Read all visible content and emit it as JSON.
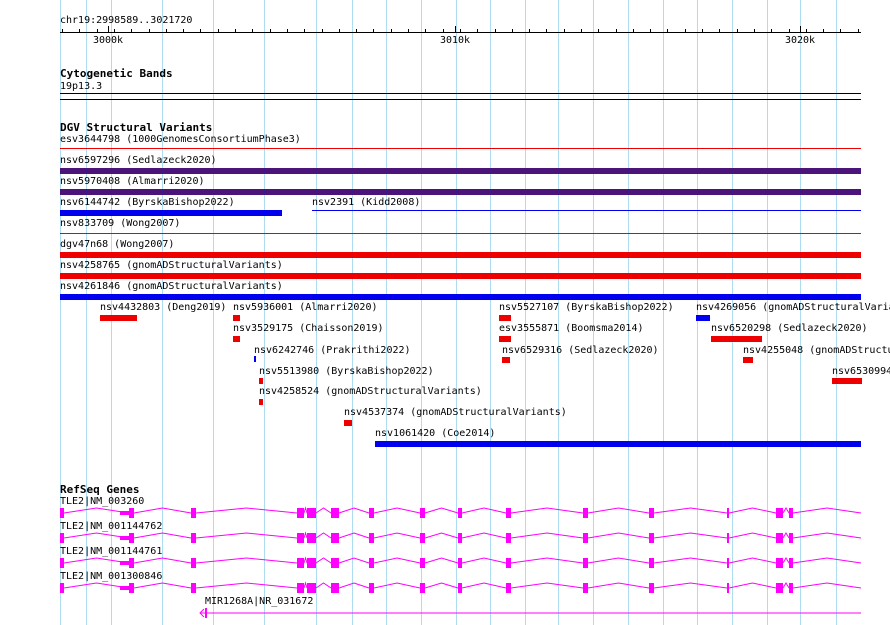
{
  "colors": {
    "grid": "#aeddf2",
    "red": "#ee0000",
    "purple": "#4a147a",
    "blue": "#0000ee",
    "gene": "#ff00ff"
  },
  "ruler": {
    "position": "chr19:2998589..3021720",
    "ticks": [
      {
        "label": "3000k"
      },
      {
        "label": "3010k"
      },
      {
        "label": "3020k"
      }
    ]
  },
  "cytobands": {
    "title": "Cytogenetic Bands",
    "band": "19p13.3"
  },
  "dgv": {
    "title": "DGV Structural Variants",
    "features": [
      {
        "label": "esv3644798 (1000GenomesConsortiumPhase3)",
        "color": "red",
        "style": "thin"
      },
      {
        "label": "nsv6597296 (Sedlazeck2020)",
        "color": "purple",
        "style": "thick"
      },
      {
        "label": "nsv5970408 (Almarri2020)",
        "color": "purple",
        "style": "thick"
      },
      {
        "label": "nsv6144742 (ByrskaBishop2022)",
        "color": "blue",
        "style": "thick"
      },
      {
        "label": "nsv2391 (Kidd2008)",
        "color": "blue",
        "style": "thin"
      },
      {
        "label": "nsv833709 (Wong2007)",
        "color": "red",
        "style": "thin"
      },
      {
        "label": "dgv47n68 (Wong2007)",
        "color": "red",
        "style": "thick"
      },
      {
        "label": "nsv4258765 (gnomADStructuralVariants)",
        "color": "red",
        "style": "thick"
      },
      {
        "label": "nsv4261846 (gnomADStructuralVariants)",
        "color": "blue",
        "style": "thick"
      },
      {
        "label": "nsv4432803 (Deng2019)",
        "color": "red",
        "style": "thick"
      },
      {
        "label": "nsv5936001 (Almarri2020)",
        "color": "red",
        "style": "thick"
      },
      {
        "label": "nsv5527107 (ByrskaBishop2022)",
        "color": "red",
        "style": "thick"
      },
      {
        "label": "nsv4269056 (gnomADStructuralVaria",
        "color": "blue",
        "style": "thick"
      },
      {
        "label": "nsv3529175 (Chaisson2019)",
        "color": "red",
        "style": "thick"
      },
      {
        "label": "esv3555871 (Boomsma2014)",
        "color": "red",
        "style": "thick"
      },
      {
        "label": "nsv6520298 (Sedlazeck2020)",
        "color": "red",
        "style": "thick"
      },
      {
        "label": "nsv6242746 (Prakrithi2022)",
        "color": "blue",
        "style": "thick"
      },
      {
        "label": "nsv6529316 (Sedlazeck2020)",
        "color": "red",
        "style": "thick"
      },
      {
        "label": "nsv4255048 (gnomADStructu",
        "color": "red",
        "style": "thick"
      },
      {
        "label": "nsv5513980 (ByrskaBishop2022)",
        "color": "red",
        "style": "thick"
      },
      {
        "label": "nsv6530994",
        "color": "red",
        "style": "thick"
      },
      {
        "label": "nsv4258524 (gnomADStructuralVariants)",
        "color": "red",
        "style": "thick"
      },
      {
        "label": "nsv4537374 (gnomADStructuralVariants)",
        "color": "red",
        "style": "thick"
      },
      {
        "label": "nsv1061420 (Coe2014)",
        "color": "blue",
        "style": "thick"
      }
    ]
  },
  "refseq": {
    "title": "RefSeq Genes",
    "transcripts": [
      {
        "label": "TLE2|NM_003260"
      },
      {
        "label": "TLE2|NM_001144762"
      },
      {
        "label": "TLE2|NM_001144761"
      },
      {
        "label": "TLE2|NM_001300846"
      },
      {
        "label": "MIR1268A|NR_031672"
      }
    ]
  }
}
